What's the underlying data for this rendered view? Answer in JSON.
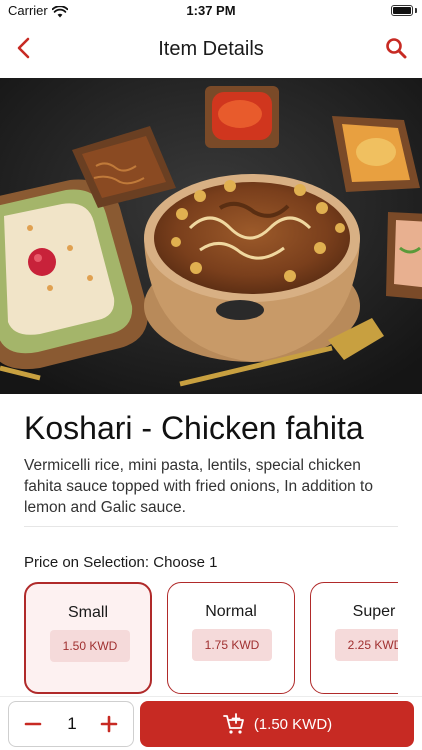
{
  "status_bar": {
    "carrier": "Carrier",
    "time": "1:37 PM"
  },
  "nav": {
    "title": "Item Details",
    "back_icon": "chevron-left-icon",
    "search_icon": "search-icon",
    "accent": "#c72a23"
  },
  "item": {
    "title": "Koshari - Chicken fahita",
    "description": "Vermicelli rice, mini pasta, lentils, special chicken fahita sauce topped with fried onions, In addition to lemon and Galic sauce."
  },
  "selection": {
    "label": "Price on Selection: Choose 1",
    "options": [
      {
        "name": "Small",
        "price": "1.50 KWD",
        "selected": true
      },
      {
        "name": "Normal",
        "price": "1.75 KWD",
        "selected": false
      },
      {
        "name": "Super",
        "price": "2.25 KWD",
        "selected": false
      }
    ]
  },
  "cart": {
    "quantity": "1",
    "button_label": "(1.50 KWD)",
    "icon": "add-to-cart-icon"
  }
}
